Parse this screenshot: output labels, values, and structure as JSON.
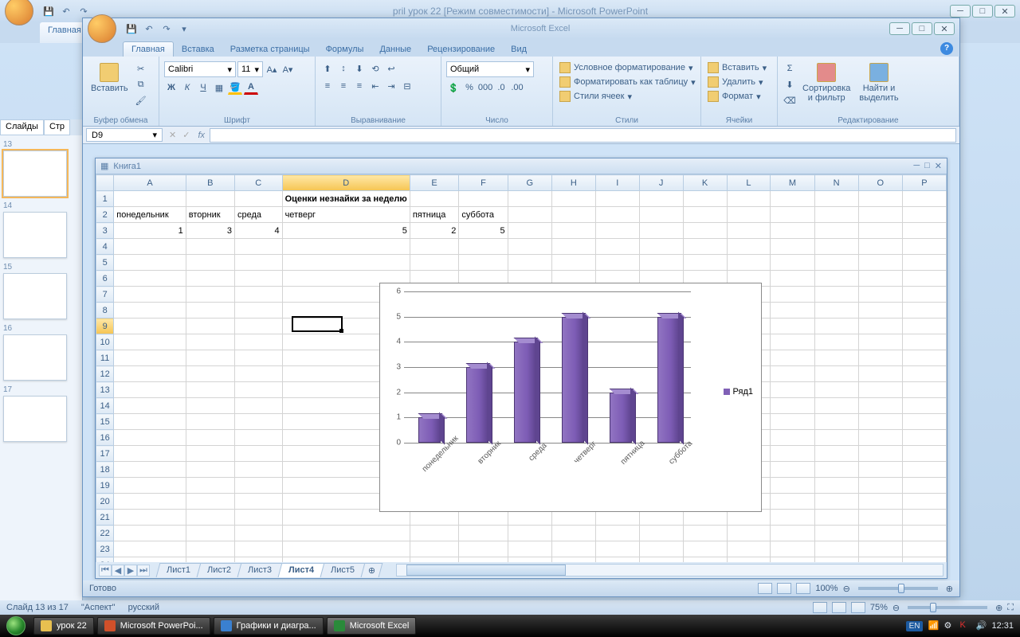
{
  "powerpoint": {
    "title": "pril урок 22 [Режим совместимости] - Microsoft PowerPoint",
    "tab_home": "Главная",
    "panel_tabs": {
      "slides": "Слайды",
      "structure": "Стр"
    },
    "thumbs": [
      "13",
      "14",
      "15",
      "16",
      "17"
    ],
    "status_slide": "Слайд 13 из 17",
    "status_theme": "\"Аспект\"",
    "status_lang": "русский",
    "zoom": "75%"
  },
  "excel": {
    "title": "Microsoft Excel",
    "tabs": [
      "Главная",
      "Вставка",
      "Разметка страницы",
      "Формулы",
      "Данные",
      "Рецензирование",
      "Вид"
    ],
    "active_tab": 0,
    "groups": {
      "clipboard": "Буфер обмена",
      "clipboard_paste": "Вставить",
      "font": "Шрифт",
      "font_name": "Calibri",
      "font_size": "11",
      "align": "Выравнивание",
      "number": "Число",
      "number_format": "Общий",
      "styles": "Стили",
      "styles_cond": "Условное форматирование",
      "styles_table": "Форматировать как таблицу",
      "styles_cell": "Стили ячеек",
      "cells": "Ячейки",
      "cells_insert": "Вставить",
      "cells_delete": "Удалить",
      "cells_format": "Формат",
      "editing": "Редактирование",
      "editing_sort": "Сортировка\nи фильтр",
      "editing_find": "Найти и\nвыделить"
    },
    "namebox": "D9",
    "workbook": "Книга1",
    "columns": [
      "A",
      "B",
      "C",
      "D",
      "E",
      "F",
      "G",
      "H",
      "I",
      "J",
      "K",
      "L",
      "M",
      "N",
      "O",
      "P"
    ],
    "rows": 24,
    "cells": {
      "title": "Оценки незнайки за неделю",
      "headers": [
        "понедельник",
        "вторник",
        "среда",
        "четверг",
        "пятница",
        "суббота"
      ],
      "values": [
        "1",
        "3",
        "4",
        "5",
        "2",
        "5"
      ]
    },
    "sheets": [
      "Лист1",
      "Лист2",
      "Лист3",
      "Лист4",
      "Лист5"
    ],
    "active_sheet": 3,
    "status": "Готово",
    "zoom": "100%"
  },
  "chart_data": {
    "type": "bar",
    "categories": [
      "понедельник",
      "вторник",
      "среда",
      "четверг",
      "пятница",
      "суббота"
    ],
    "values": [
      1,
      3,
      4,
      5,
      2,
      5
    ],
    "series_name": "Ряд1",
    "ylim": [
      0,
      6
    ],
    "yticks": [
      0,
      1,
      2,
      3,
      4,
      5,
      6
    ]
  },
  "taskbar": {
    "items": [
      "урок 22",
      "Microsoft PowerPoi...",
      "Графики и диагра...",
      "Microsoft Excel"
    ],
    "lang": "EN",
    "time": "12:31"
  }
}
